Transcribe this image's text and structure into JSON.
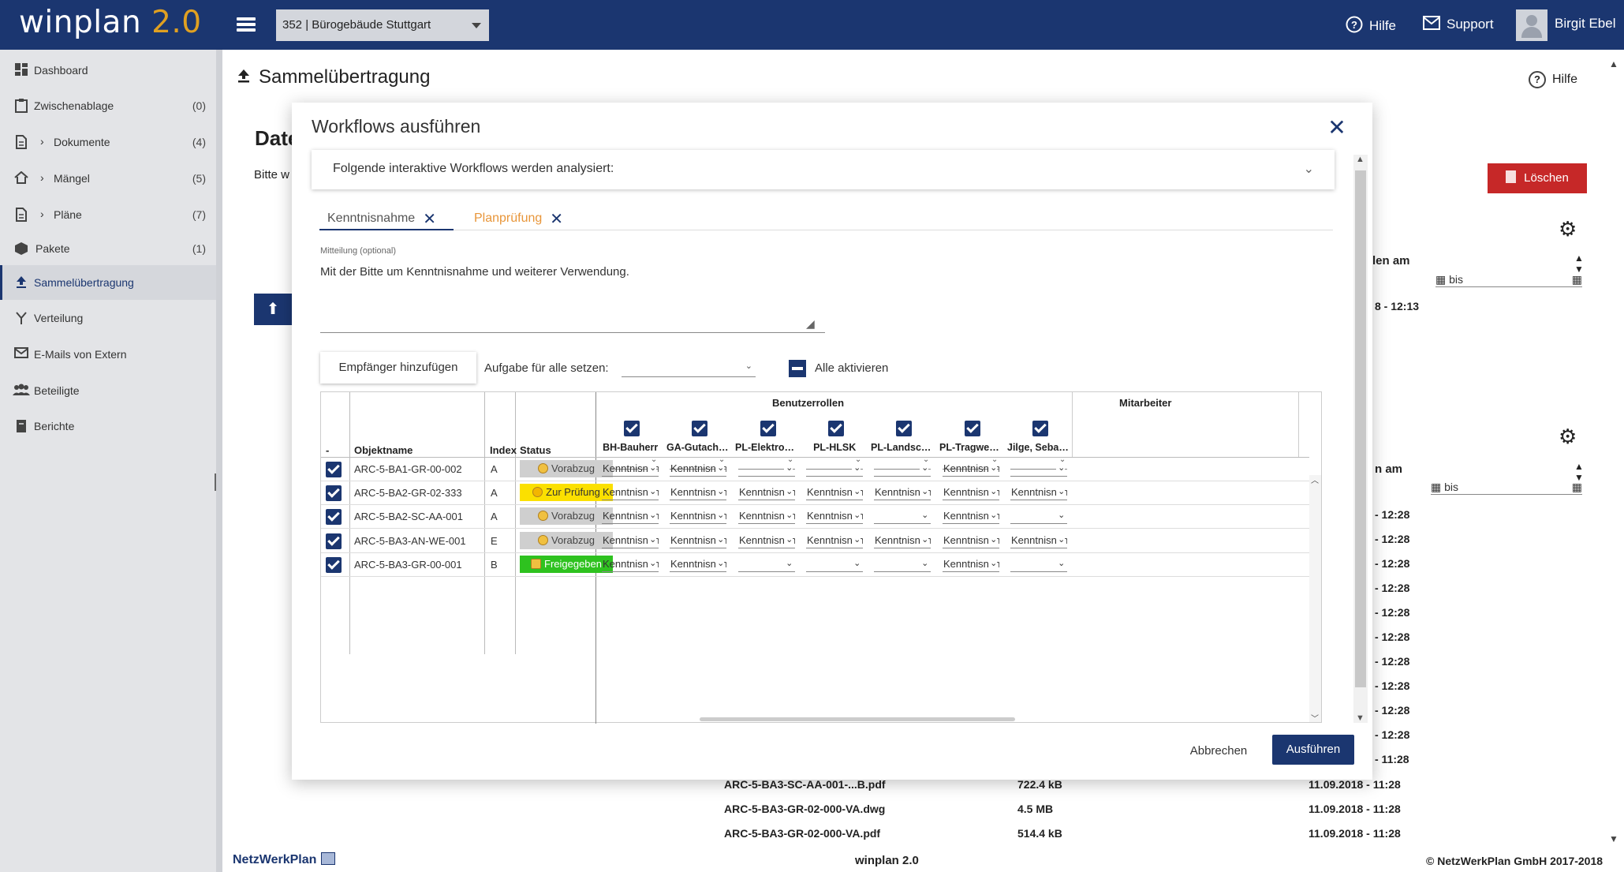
{
  "app": {
    "logo_name": "winplan",
    "logo_version": "2.0"
  },
  "header": {
    "project": "352 | Bürogebäude Stuttgart",
    "help": "Hilfe",
    "support": "Support",
    "user": "Birgit Ebel"
  },
  "sidebar": {
    "items": [
      {
        "label": "Dashboard",
        "count": ""
      },
      {
        "label": "Zwischenablage",
        "count": "(0)"
      },
      {
        "label": "Dokumente",
        "count": "(4)"
      },
      {
        "label": "Mängel",
        "count": "(5)"
      },
      {
        "label": "Pläne",
        "count": "(7)"
      },
      {
        "label": "Pakete",
        "count": "(1)"
      },
      {
        "label": "Sammelübertragung",
        "count": ""
      },
      {
        "label": "Verteilung",
        "count": ""
      },
      {
        "label": "E-Mails von Extern",
        "count": ""
      },
      {
        "label": "Beteiligte",
        "count": ""
      },
      {
        "label": "Berichte",
        "count": ""
      }
    ]
  },
  "page": {
    "title": "Sammelübertragung",
    "help": "Hilfe",
    "heading_fragment": "Date",
    "text_fragment": "Bitte w",
    "delete": "Löschen",
    "col_label_1": "len am",
    "col_label_2": "n am",
    "filter_bis": "bis",
    "times": [
      "8 - 12:13",
      "- 12:28",
      "- 12:28",
      "- 12:28",
      "- 12:28",
      "- 12:28",
      "- 12:28",
      "- 12:28",
      "- 12:28",
      "- 12:28",
      "- 12:28",
      "- 11:28"
    ],
    "files": [
      {
        "name": "ARC-5-BA3-SC-AA-001-...B.pdf",
        "size": "722.4 kB",
        "date": "11.09.2018 - 11:28"
      },
      {
        "name": "ARC-5-BA3-GR-02-000-VA.dwg",
        "size": "4.5 MB",
        "date": "11.09.2018 - 11:28"
      },
      {
        "name": "ARC-5-BA3-GR-02-000-VA.pdf",
        "size": "514.4 kB",
        "date": "11.09.2018 - 11:28"
      }
    ]
  },
  "footer": {
    "brand": "NetzWerkPlan",
    "center": "winplan 2.0",
    "copyright": "© NetzWerkPlan GmbH 2017-2018"
  },
  "modal": {
    "title": "Workflows ausführen",
    "accordion": "Folgende interaktive Workflows werden analysiert:",
    "tabs": [
      "Kenntnisnahme",
      "Planprüfung"
    ],
    "message_label": "Mitteilung (optional)",
    "message": "Mit der Bitte um Kenntnisnahme und weiterer Verwendung.",
    "add_recipient": "Empfänger hinzufügen",
    "task_all_label": "Aufgabe für alle setzen:",
    "activate_all": "Alle aktivieren",
    "cancel": "Abbrechen",
    "run": "Ausführen",
    "table": {
      "group_roles": "Benutzerrollen",
      "group_staff": "Mitarbeiter",
      "col_dash": "-",
      "col_object": "Objektname",
      "col_index": "Index",
      "col_status": "Status",
      "roles": [
        "BH-Bauherr",
        "GA-Gutachter...",
        "PL-Elektropla...",
        "PL-HLSK",
        "PL-Landschaf...",
        "PL-Tragwerks...",
        "Jilge, Sebasti..."
      ],
      "rows": [
        {
          "name": "ARC-5-BA1-GR-00-002",
          "index": "A",
          "status": "Vorabzug",
          "status_type": "vorabzug",
          "cells": [
            "Kenntnisnah",
            "Kenntnisnah",
            "",
            "",
            "",
            "Kenntnisnah",
            ""
          ]
        },
        {
          "name": "ARC-5-BA2-GR-02-333",
          "index": "A",
          "status": "Zur Prüfung",
          "status_type": "pruefung",
          "cells": [
            "Kenntnisnah",
            "Kenntnisnah",
            "Kenntnisnah",
            "Kenntnisnah",
            "Kenntnisnah",
            "Kenntnisnah",
            "Kenntnisnah"
          ]
        },
        {
          "name": "ARC-5-BA2-SC-AA-001",
          "index": "A",
          "status": "Vorabzug",
          "status_type": "vorabzug",
          "cells": [
            "Kenntnisnah",
            "Kenntnisnah",
            "Kenntnisnah",
            "Kenntnisnah",
            "",
            "Kenntnisnah",
            ""
          ]
        },
        {
          "name": "ARC-5-BA3-AN-WE-001",
          "index": "E",
          "status": "Vorabzug",
          "status_type": "vorabzug",
          "cells": [
            "Kenntnisnah",
            "Kenntnisnah",
            "Kenntnisnah",
            "Kenntnisnah",
            "Kenntnisnah",
            "Kenntnisnah",
            "Kenntnisnah"
          ]
        },
        {
          "name": "ARC-5-BA3-GR-00-001",
          "index": "B",
          "status": "Freigegeben",
          "status_type": "frei",
          "cells": [
            "Kenntnisnah",
            "Kenntnisnah",
            "",
            "",
            "",
            "Kenntnisnah",
            ""
          ]
        }
      ]
    }
  },
  "colors": {
    "primary": "#1b3670",
    "accent": "#e0a021",
    "danger": "#c62828",
    "status_yellow": "#fbe000",
    "status_green": "#2ec21f"
  }
}
